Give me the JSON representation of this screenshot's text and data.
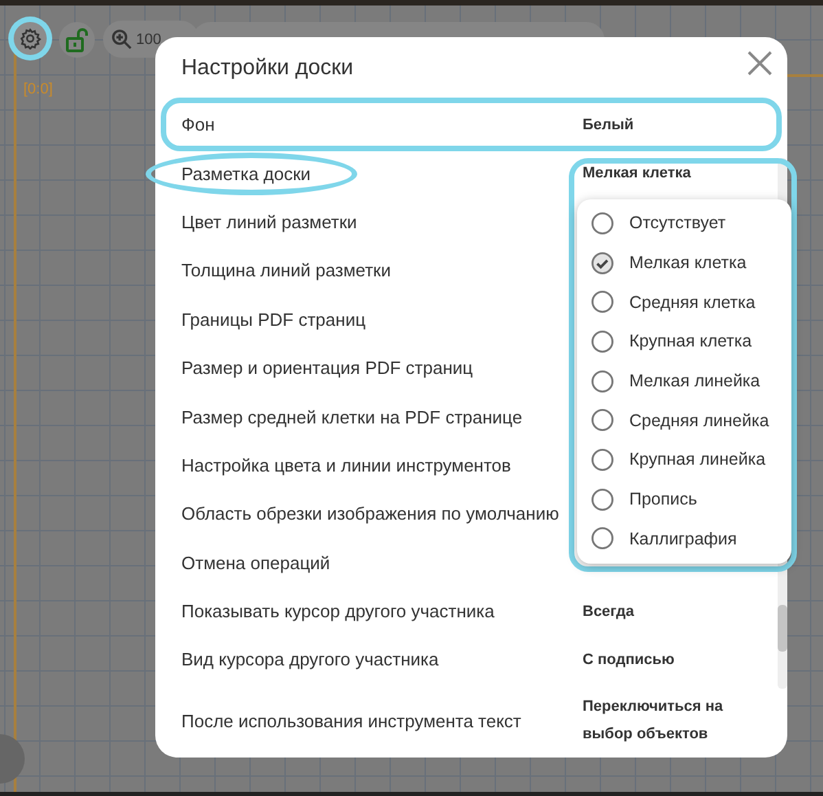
{
  "toolbar": {
    "settings_highlighted": true,
    "zoom": "100"
  },
  "canvas": {
    "origin_label": "[0:0]"
  },
  "dialog": {
    "title": "Настройки доски",
    "settings": [
      {
        "label": "Фон",
        "value": "Белый",
        "boxed": true
      },
      {
        "label": "Разметка доски",
        "value": "Мелкая клетка",
        "circled": true
      },
      {
        "label": "Цвет линий разметки"
      },
      {
        "label": "Толщина линий разметки"
      },
      {
        "label": "Границы PDF страниц"
      },
      {
        "label": "Размер и ориентация PDF страниц"
      },
      {
        "label": "Размер средней клетки на PDF странице"
      },
      {
        "label": "Настройка цвета и линии инструментов"
      },
      {
        "label": "Область обрезки изображения по умолчанию"
      },
      {
        "label": "Отмена операций"
      },
      {
        "label": "Показывать курсор другого участника",
        "value": "Всегда"
      },
      {
        "label": "Вид курсора другого участника",
        "value": "С подписью"
      },
      {
        "label": "После использования инструмента текст",
        "value": "Переключиться на выбор объектов"
      }
    ],
    "dropdown": {
      "highlighted": true,
      "options": [
        {
          "label": "Отсутствует",
          "selected": false
        },
        {
          "label": "Мелкая клетка",
          "selected": true
        },
        {
          "label": "Средняя клетка",
          "selected": false
        },
        {
          "label": "Крупная клетка",
          "selected": false
        },
        {
          "label": "Мелкая линейка",
          "selected": false
        },
        {
          "label": "Средняя линейка",
          "selected": false
        },
        {
          "label": "Крупная линейка",
          "selected": false
        },
        {
          "label": "Пропись",
          "selected": false
        },
        {
          "label": "Каллиграфия",
          "selected": false
        }
      ]
    }
  }
}
